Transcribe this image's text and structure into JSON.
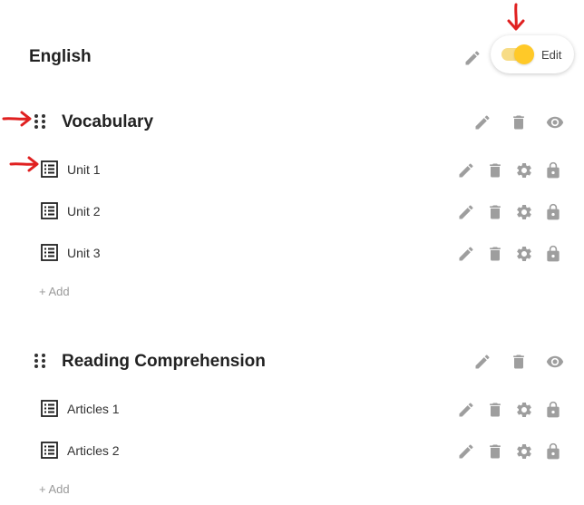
{
  "header": {
    "title": "English",
    "toggle_label": "Edit",
    "toggle_on": true
  },
  "sections": [
    {
      "title": "Vocabulary",
      "items": [
        {
          "label": "Unit 1"
        },
        {
          "label": "Unit 2"
        },
        {
          "label": "Unit 3"
        }
      ],
      "add_label": "+ Add"
    },
    {
      "title": "Reading Comprehension",
      "items": [
        {
          "label": "Articles 1"
        },
        {
          "label": "Articles 2"
        }
      ],
      "add_label": "+ Add"
    }
  ],
  "colors": {
    "icon_gray": "#9e9e9e",
    "toggle_track": "#f7dc86",
    "toggle_knob": "#ffc928",
    "annotation_arrow": "#e02020"
  },
  "icons": {
    "edit": "pencil-icon",
    "delete": "trash-icon",
    "visibility": "eye-icon",
    "settings": "gear-icon",
    "lock": "lock-icon",
    "drag": "drag-handle-icon",
    "list": "list-icon"
  }
}
